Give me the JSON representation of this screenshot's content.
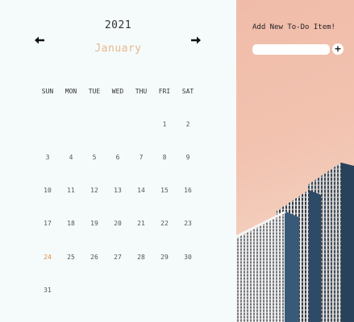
{
  "calendar": {
    "year": "2021",
    "month": "January",
    "prev_icon": "arrow-left-icon",
    "next_icon": "arrow-right-icon",
    "weekdays": [
      "SUN",
      "MON",
      "TUE",
      "WED",
      "THU",
      "FRI",
      "SAT"
    ],
    "weeks": [
      [
        "",
        "",
        "",
        "",
        "",
        "1",
        "2"
      ],
      [
        "3",
        "4",
        "5",
        "6",
        "7",
        "8",
        "9"
      ],
      [
        "10",
        "11",
        "12",
        "13",
        "14",
        "15",
        "16"
      ],
      [
        "17",
        "18",
        "19",
        "20",
        "21",
        "22",
        "23"
      ],
      [
        "24",
        "25",
        "26",
        "27",
        "28",
        "29",
        "30"
      ],
      [
        "31",
        "",
        "",
        "",
        "",
        "",
        ""
      ]
    ],
    "highlighted_day": "24",
    "highlight_color": "#e08a4a",
    "month_color": "#e8b890"
  },
  "todo": {
    "title": "Add New To-Do Item!",
    "input_value": "",
    "input_placeholder": "",
    "add_label": "+"
  },
  "background": {
    "image": "office-building-photo",
    "colors": [
      "#f0bca9",
      "#f6e0d2"
    ]
  }
}
